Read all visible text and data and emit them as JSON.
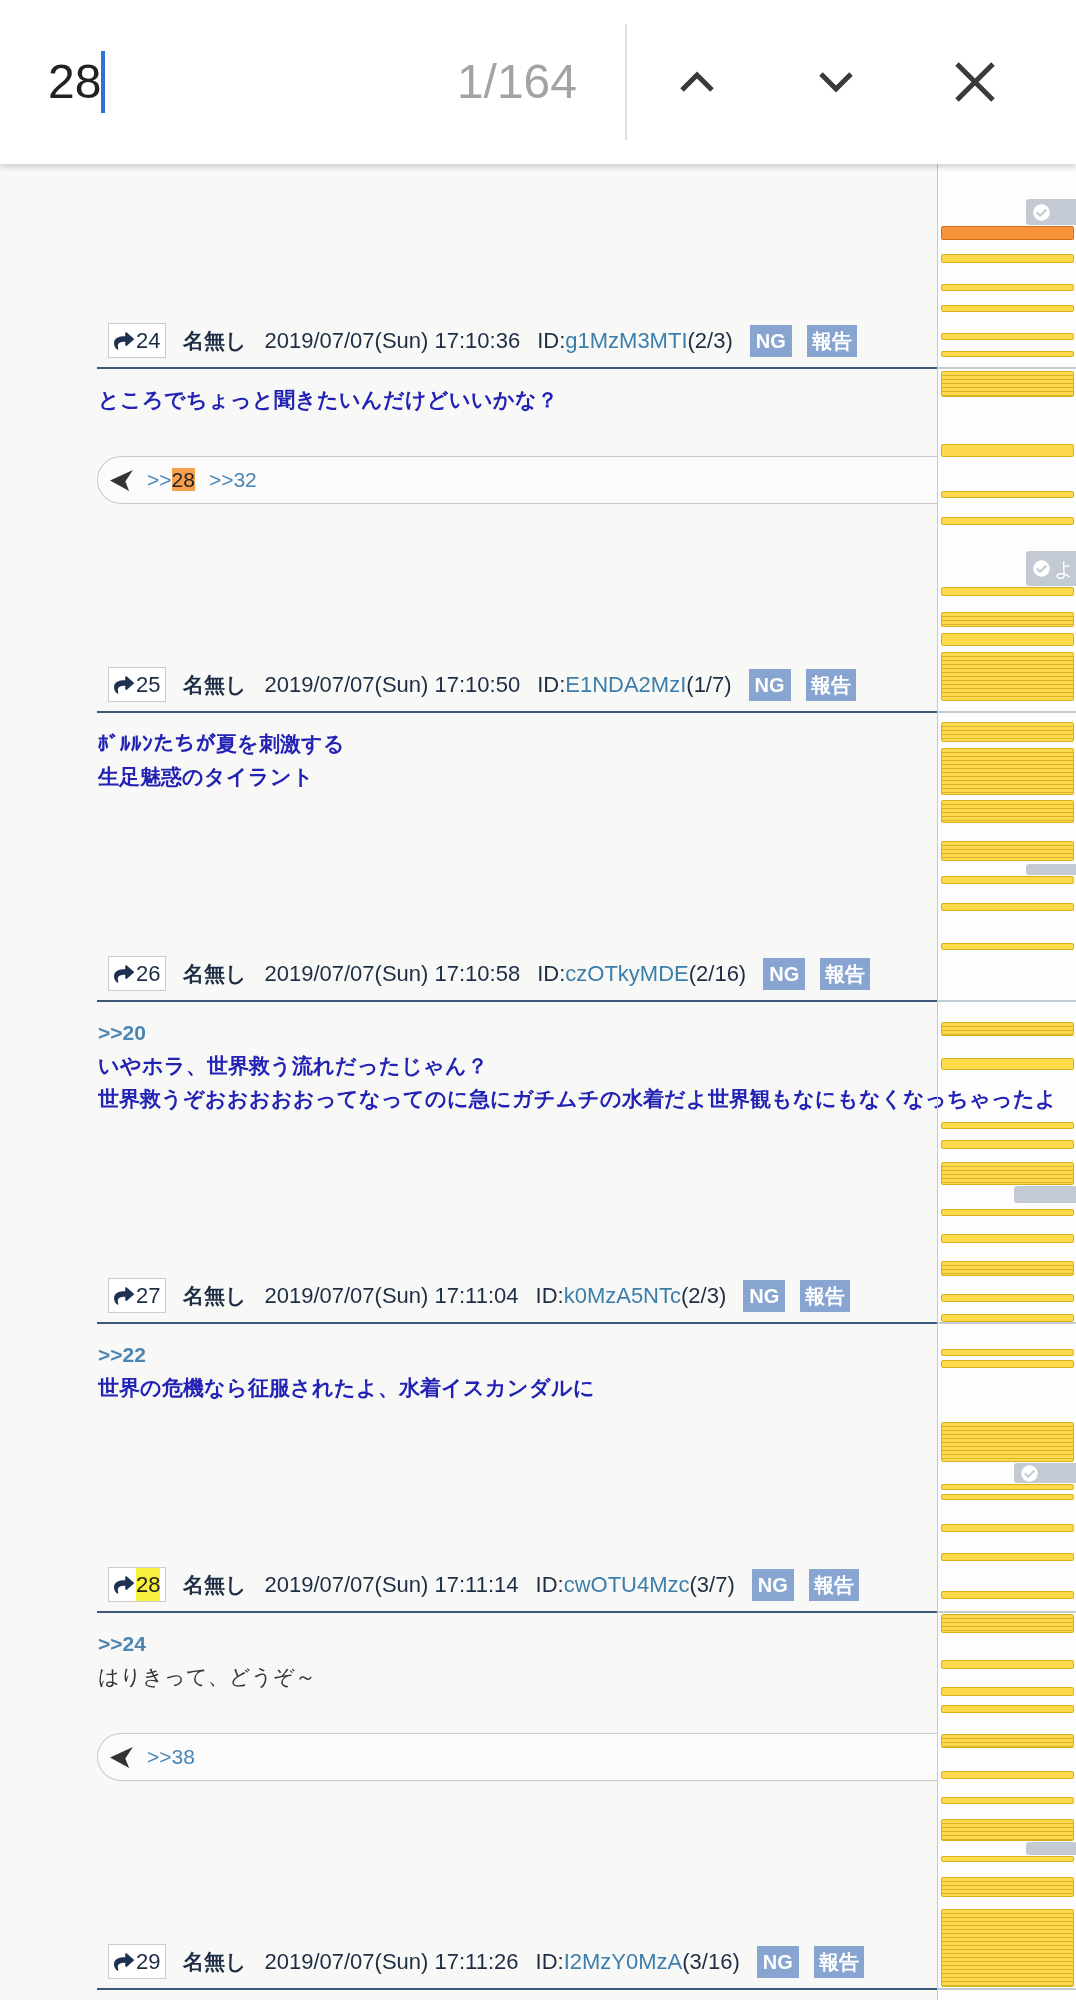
{
  "find_bar": {
    "query": "28",
    "match_count": "1/164"
  },
  "posts": [
    {
      "number": "24",
      "number_match": false,
      "name": "名無し",
      "date": "2019/07/07(Sun) 17:10:36",
      "id_label": "ID:",
      "id": "g1MzM3MTI",
      "id_count": "(2/3)",
      "ng_button": "NG",
      "report_button": "報告",
      "body": [
        {
          "kind": "message",
          "text": "ところでちょっと聞きたいんだけどいいかな？"
        }
      ],
      "replies": [
        {
          "prefix": ">>",
          "number": "28",
          "match": true,
          "current": true
        },
        {
          "prefix": ">>",
          "number": "32",
          "match": false,
          "current": false
        }
      ]
    },
    {
      "number": "25",
      "number_match": false,
      "name": "名無し",
      "date": "2019/07/07(Sun) 17:10:50",
      "id_label": "ID:",
      "id": "E1NDA2MzI",
      "id_count": "(1/7)",
      "ng_button": "NG",
      "report_button": "報告",
      "body": [
        {
          "kind": "message",
          "text": "ﾎﾞﾙﾙﾝたちが夏を刺激する"
        },
        {
          "kind": "message",
          "text": "生足魅惑のタイラント"
        }
      ]
    },
    {
      "number": "26",
      "number_match": false,
      "name": "名無し",
      "date": "2019/07/07(Sun) 17:10:58",
      "id_label": "ID:",
      "id": "czOTkyMDE",
      "id_count": "(2/16)",
      "ng_button": "NG",
      "report_button": "報告",
      "body": [
        {
          "kind": "anchor",
          "text": ">>20"
        },
        {
          "kind": "message",
          "text": "いやホラ、世界救う流れだったじゃん？"
        },
        {
          "kind": "message",
          "text": "世界救うぞおおおおおってなってのに急にガチムチの水着だよ世界観もなにもなくなっちゃったよ"
        }
      ]
    },
    {
      "number": "27",
      "number_match": false,
      "name": "名無し",
      "date": "2019/07/07(Sun) 17:11:04",
      "id_label": "ID:",
      "id": "k0MzA5NTc",
      "id_count": "(2/3)",
      "ng_button": "NG",
      "report_button": "報告",
      "body": [
        {
          "kind": "anchor",
          "text": ">>22"
        },
        {
          "kind": "message",
          "text": "世界の危機なら征服されたよ、水着イスカンダルに"
        }
      ]
    },
    {
      "number": "28",
      "number_match": true,
      "name": "名無し",
      "date": "2019/07/07(Sun) 17:11:14",
      "id_label": "ID:",
      "id": "cwOTU4Mzc",
      "id_count": "(3/7)",
      "ng_button": "NG",
      "report_button": "報告",
      "body": [
        {
          "kind": "anchor",
          "text": ">>24"
        },
        {
          "kind": "plain",
          "text": "はりきって、どうぞ～"
        }
      ],
      "replies": [
        {
          "prefix": ">>",
          "number": "38",
          "match": false,
          "current": false
        }
      ]
    },
    {
      "number": "29",
      "number_match": false,
      "name": "名無し",
      "date": "2019/07/07(Sun) 17:11:26",
      "id_label": "ID:",
      "id": "I2MzY0MzA",
      "id_count": "(3/16)",
      "ng_button": "NG",
      "report_button": "報告"
    }
  ],
  "side_tabs": [
    {
      "check": true
    },
    {
      "check": true,
      "label": "よ"
    },
    {
      "check": false
    },
    {
      "check": false
    },
    {
      "check": true
    },
    {
      "check": false
    }
  ]
}
